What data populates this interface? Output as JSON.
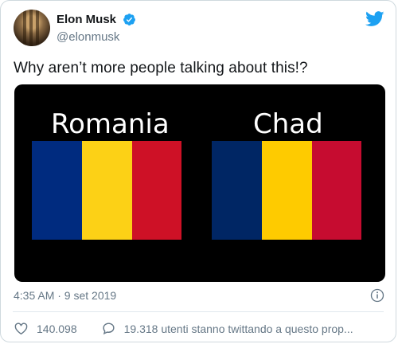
{
  "user": {
    "display_name": "Elon Musk",
    "handle": "@elonmusk",
    "verified": true
  },
  "tweet": {
    "text": "Why aren’t more people talking about this!?",
    "timestamp": "4:35 AM · 9 set 2019"
  },
  "media": {
    "left_flag": {
      "label": "Romania",
      "colors": [
        "#002B7F",
        "#FCD116",
        "#CE1126"
      ]
    },
    "right_flag": {
      "label": "Chad",
      "colors": [
        "#002664",
        "#FECB00",
        "#C60C30"
      ]
    }
  },
  "stats": {
    "likes": "140.098",
    "reply_text": "19.318 utenti stanno twittando a questo prop..."
  },
  "colors": {
    "twitter_blue": "#1DA1F2",
    "secondary_text": "#657786"
  },
  "icons": {
    "verified": "verified-badge-icon",
    "logo": "twitter-bird-icon",
    "info": "info-icon",
    "like": "heart-icon",
    "reply": "speech-bubble-icon"
  }
}
